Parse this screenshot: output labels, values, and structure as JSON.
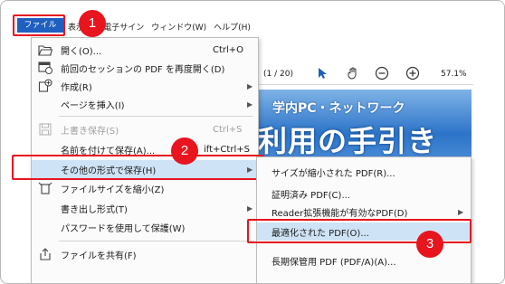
{
  "menubar": {
    "file": "ファイル (F)",
    "view": "表示(V)",
    "esign": "電子サイン",
    "window": "ウィンドウ(W)",
    "help": "ヘルプ(H)"
  },
  "badges": [
    "1",
    "2",
    "3"
  ],
  "toolbar": {
    "page_count": "(1 / 20)",
    "zoom": "57.1%",
    "icons": [
      "select-arrow-icon",
      "hand-icon",
      "zoom-out-icon",
      "zoom-in-icon"
    ]
  },
  "document": {
    "banner_subtitle": "学内PC・ネットワーク",
    "banner_title": "利用の手引き"
  },
  "file_menu": {
    "items": [
      {
        "label": "開く(O)...",
        "shortcut": "Ctrl+O",
        "icon": "folder-icon"
      },
      {
        "label": "前回のセッションの PDF を再度開く(D)",
        "shortcut": "",
        "icon": "session-icon"
      },
      {
        "label": "作成(R)",
        "shortcut": "",
        "icon": "create-icon",
        "submenu": true
      },
      {
        "label": "ページを挿入(I)",
        "shortcut": "",
        "icon": "",
        "submenu": true
      },
      {
        "label": "上書き保存(S)",
        "shortcut": "Ctrl+S",
        "icon": "save-icon",
        "disabled": true
      },
      {
        "label": "名前を付けて保存(A)...",
        "shortcut": "ift+Ctrl+S",
        "icon": ""
      },
      {
        "label": "その他の形式で保存(H)",
        "shortcut": "",
        "icon": "",
        "submenu": true,
        "highlighted": true
      },
      {
        "label": "ファイルサイズを縮小(Z)",
        "shortcut": "",
        "icon": "reduce-size-icon"
      },
      {
        "label": "書き出し形式(T)",
        "shortcut": "",
        "icon": "",
        "submenu": true
      },
      {
        "label": "パスワードを使用して保護(W)",
        "shortcut": "",
        "icon": ""
      },
      {
        "label": "ファイルを共有(F)",
        "shortcut": "",
        "icon": "share-icon"
      }
    ]
  },
  "save_other_submenu": {
    "items": [
      {
        "label": "サイズが縮小された PDF(R)..."
      },
      {
        "label": "証明済み PDF(C)..."
      },
      {
        "label": "Reader拡張機能が有効なPDF(D)",
        "submenu": true
      },
      {
        "label": "最適化された PDF(O)...",
        "highlighted": true
      },
      {
        "label": "長期保管用 PDF (PDF/A)(A)..."
      }
    ]
  }
}
